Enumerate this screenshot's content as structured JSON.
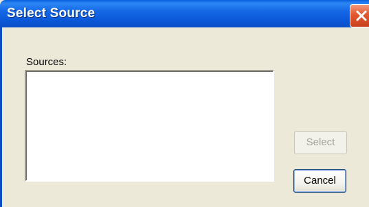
{
  "window": {
    "title": "Select Source"
  },
  "dialog": {
    "sources_label": "Sources:",
    "sources": [],
    "buttons": {
      "select": "Select",
      "cancel": "Cancel"
    }
  },
  "colors": {
    "titlebar": "#0b57d8",
    "dialog_bg": "#ece9d8",
    "close_button": "#e2572f"
  },
  "icons": {
    "close": "close-icon"
  }
}
